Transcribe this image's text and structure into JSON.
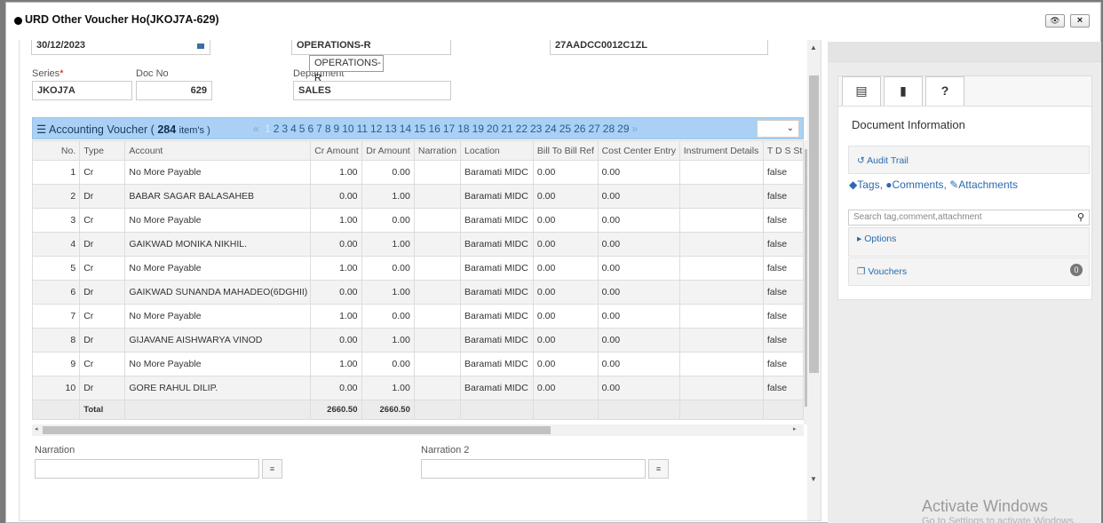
{
  "window": {
    "title": "URD Other Voucher Ho(JKOJ7A-629)",
    "btn_eye": "👁",
    "btn_close": "×"
  },
  "form": {
    "date_value": "30/12/2023",
    "operations_value": "OPERATIONS-R",
    "gst_value": "27AADCC0012C1ZL",
    "tooltip": "OPERATIONS-R",
    "series_label": "Series",
    "series_required": "*",
    "series_value": "JKOJ7A",
    "docno_label": "Doc No",
    "docno_value": "629",
    "department_label": "Department",
    "department_value": "SALES"
  },
  "grid": {
    "title_prefix": "Accounting Voucher (",
    "item_count": "284",
    "title_suffix": "item's )",
    "pager_prev": "«",
    "pager_pages": [
      "1",
      "2",
      "3",
      "4",
      "5",
      "6",
      "7",
      "8",
      "9",
      "10",
      "11",
      "12",
      "13",
      "14",
      "15",
      "16",
      "17",
      "18",
      "19",
      "20",
      "21",
      "22",
      "23",
      "24",
      "25",
      "26",
      "27",
      "28",
      "29"
    ],
    "pager_next": "»",
    "columns": [
      "No.",
      "Type",
      "Account",
      "Cr Amount",
      "Dr Amount",
      "Narration",
      "Location",
      "Bill To Bill Ref",
      "Cost Center Entry",
      "Instrument Details",
      "T D S St"
    ],
    "rows": [
      {
        "no": "1",
        "type": "Cr",
        "account": "No More Payable",
        "cr": "1.00",
        "dr": "0.00",
        "narration": "",
        "location": "Baramati MIDC",
        "bill": "0.00",
        "cost": "0.00",
        "instrument": "",
        "tds": "false"
      },
      {
        "no": "2",
        "type": "Dr",
        "account": "BABAR SAGAR BALASAHEB",
        "cr": "0.00",
        "dr": "1.00",
        "narration": "",
        "location": "Baramati MIDC",
        "bill": "0.00",
        "cost": "0.00",
        "instrument": "",
        "tds": "false"
      },
      {
        "no": "3",
        "type": "Cr",
        "account": "No More Payable",
        "cr": "1.00",
        "dr": "0.00",
        "narration": "",
        "location": "Baramati MIDC",
        "bill": "0.00",
        "cost": "0.00",
        "instrument": "",
        "tds": "false"
      },
      {
        "no": "4",
        "type": "Dr",
        "account": "GAIKWAD MONIKA NIKHIL.",
        "cr": "0.00",
        "dr": "1.00",
        "narration": "",
        "location": "Baramati MIDC",
        "bill": "0.00",
        "cost": "0.00",
        "instrument": "",
        "tds": "false"
      },
      {
        "no": "5",
        "type": "Cr",
        "account": "No More Payable",
        "cr": "1.00",
        "dr": "0.00",
        "narration": "",
        "location": "Baramati MIDC",
        "bill": "0.00",
        "cost": "0.00",
        "instrument": "",
        "tds": "false"
      },
      {
        "no": "6",
        "type": "Dr",
        "account": "GAIKWAD SUNANDA MAHADEO(6DGHII)",
        "cr": "0.00",
        "dr": "1.00",
        "narration": "",
        "location": "Baramati MIDC",
        "bill": "0.00",
        "cost": "0.00",
        "instrument": "",
        "tds": "false"
      },
      {
        "no": "7",
        "type": "Cr",
        "account": "No More Payable",
        "cr": "1.00",
        "dr": "0.00",
        "narration": "",
        "location": "Baramati MIDC",
        "bill": "0.00",
        "cost": "0.00",
        "instrument": "",
        "tds": "false"
      },
      {
        "no": "8",
        "type": "Dr",
        "account": "GIJAVANE AISHWARYA VINOD",
        "cr": "0.00",
        "dr": "1.00",
        "narration": "",
        "location": "Baramati MIDC",
        "bill": "0.00",
        "cost": "0.00",
        "instrument": "",
        "tds": "false"
      },
      {
        "no": "9",
        "type": "Cr",
        "account": "No More Payable",
        "cr": "1.00",
        "dr": "0.00",
        "narration": "",
        "location": "Baramati MIDC",
        "bill": "0.00",
        "cost": "0.00",
        "instrument": "",
        "tds": "false"
      },
      {
        "no": "10",
        "type": "Dr",
        "account": "GORE RAHUL DILIP.",
        "cr": "0.00",
        "dr": "1.00",
        "narration": "",
        "location": "Baramati MIDC",
        "bill": "0.00",
        "cost": "0.00",
        "instrument": "",
        "tds": "false"
      }
    ],
    "total_label": "Total",
    "total_cr": "2660.50",
    "total_dr": "2660.50"
  },
  "narration": {
    "label1": "Narration",
    "label2": "Narration 2"
  },
  "side": {
    "title": "Document Information",
    "audit_trail": "Audit Trail",
    "tags_label": "Tags,",
    "comments_label": "Comments,",
    "attachments_label": "Attachments",
    "search_placeholder": "Search tag,comment,attachment",
    "options_label": "Options",
    "vouchers_label": "Vouchers",
    "vouchers_count": "0"
  },
  "watermark": {
    "line1": "Activate Windows",
    "line2": "Go to Settings to activate Windows."
  },
  "colors": {
    "grid_header_bg": "#aad1f5",
    "link": "#2a6ab0",
    "required": "#dd0000"
  }
}
